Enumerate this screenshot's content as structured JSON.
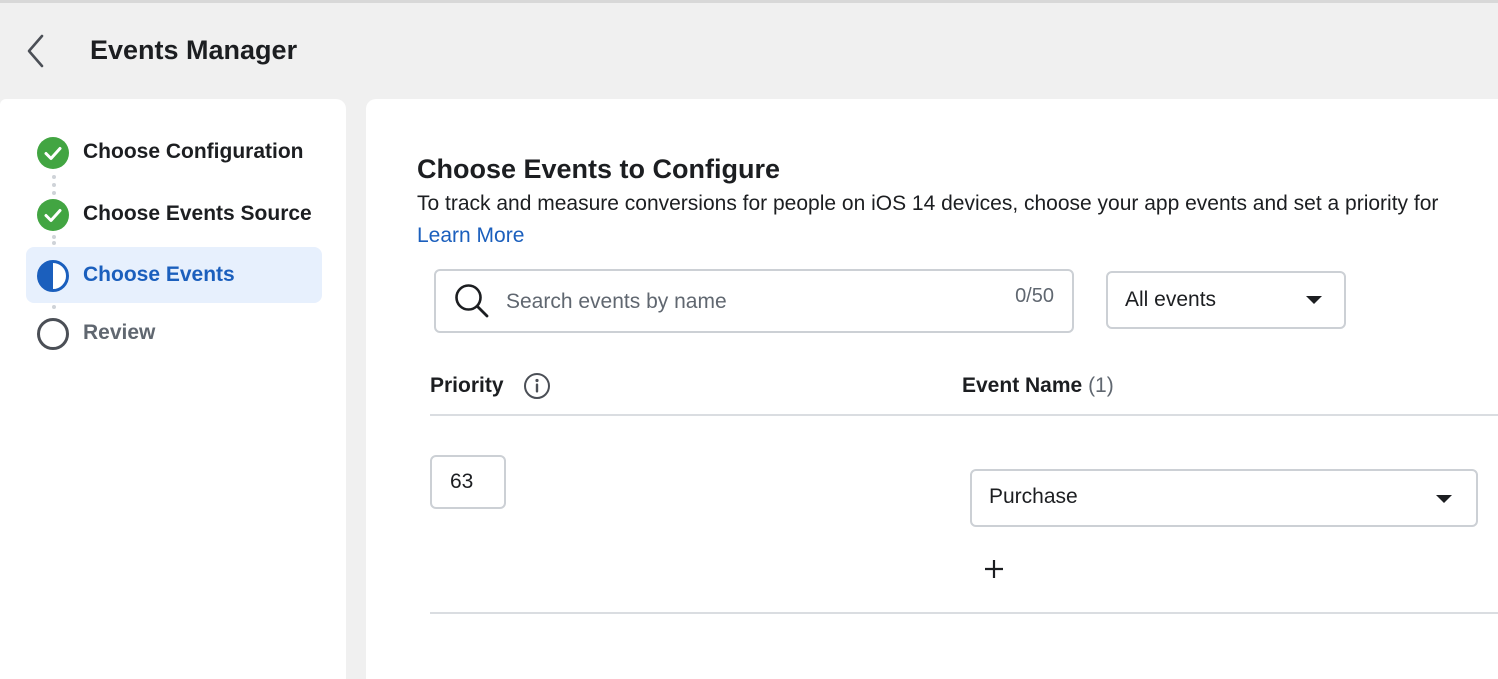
{
  "header": {
    "title": "Events Manager"
  },
  "steps": [
    {
      "label": "Choose Configuration",
      "status": "complete"
    },
    {
      "label": "Choose Events Source",
      "status": "complete"
    },
    {
      "label": "Choose Events",
      "status": "in-progress"
    },
    {
      "label": "Review",
      "status": "pending"
    }
  ],
  "main": {
    "title": "Choose Events to Configure",
    "description": "To track and measure conversions for people on iOS 14 devices, choose your app events and set a priority for",
    "learn_more": "Learn More",
    "search": {
      "placeholder": "Search events by name",
      "value": "",
      "count": "0/50"
    },
    "filter": {
      "selected": "All events"
    },
    "table": {
      "priority_header": "Priority",
      "event_header": "Event Name",
      "event_count": "(1)",
      "rows": [
        {
          "priority": "63",
          "event": "Purchase"
        }
      ]
    }
  },
  "colors": {
    "accent": "#1b5fbd",
    "success": "#42a542",
    "active_bg": "#e7f0fd",
    "border": "#ccd0d5"
  }
}
